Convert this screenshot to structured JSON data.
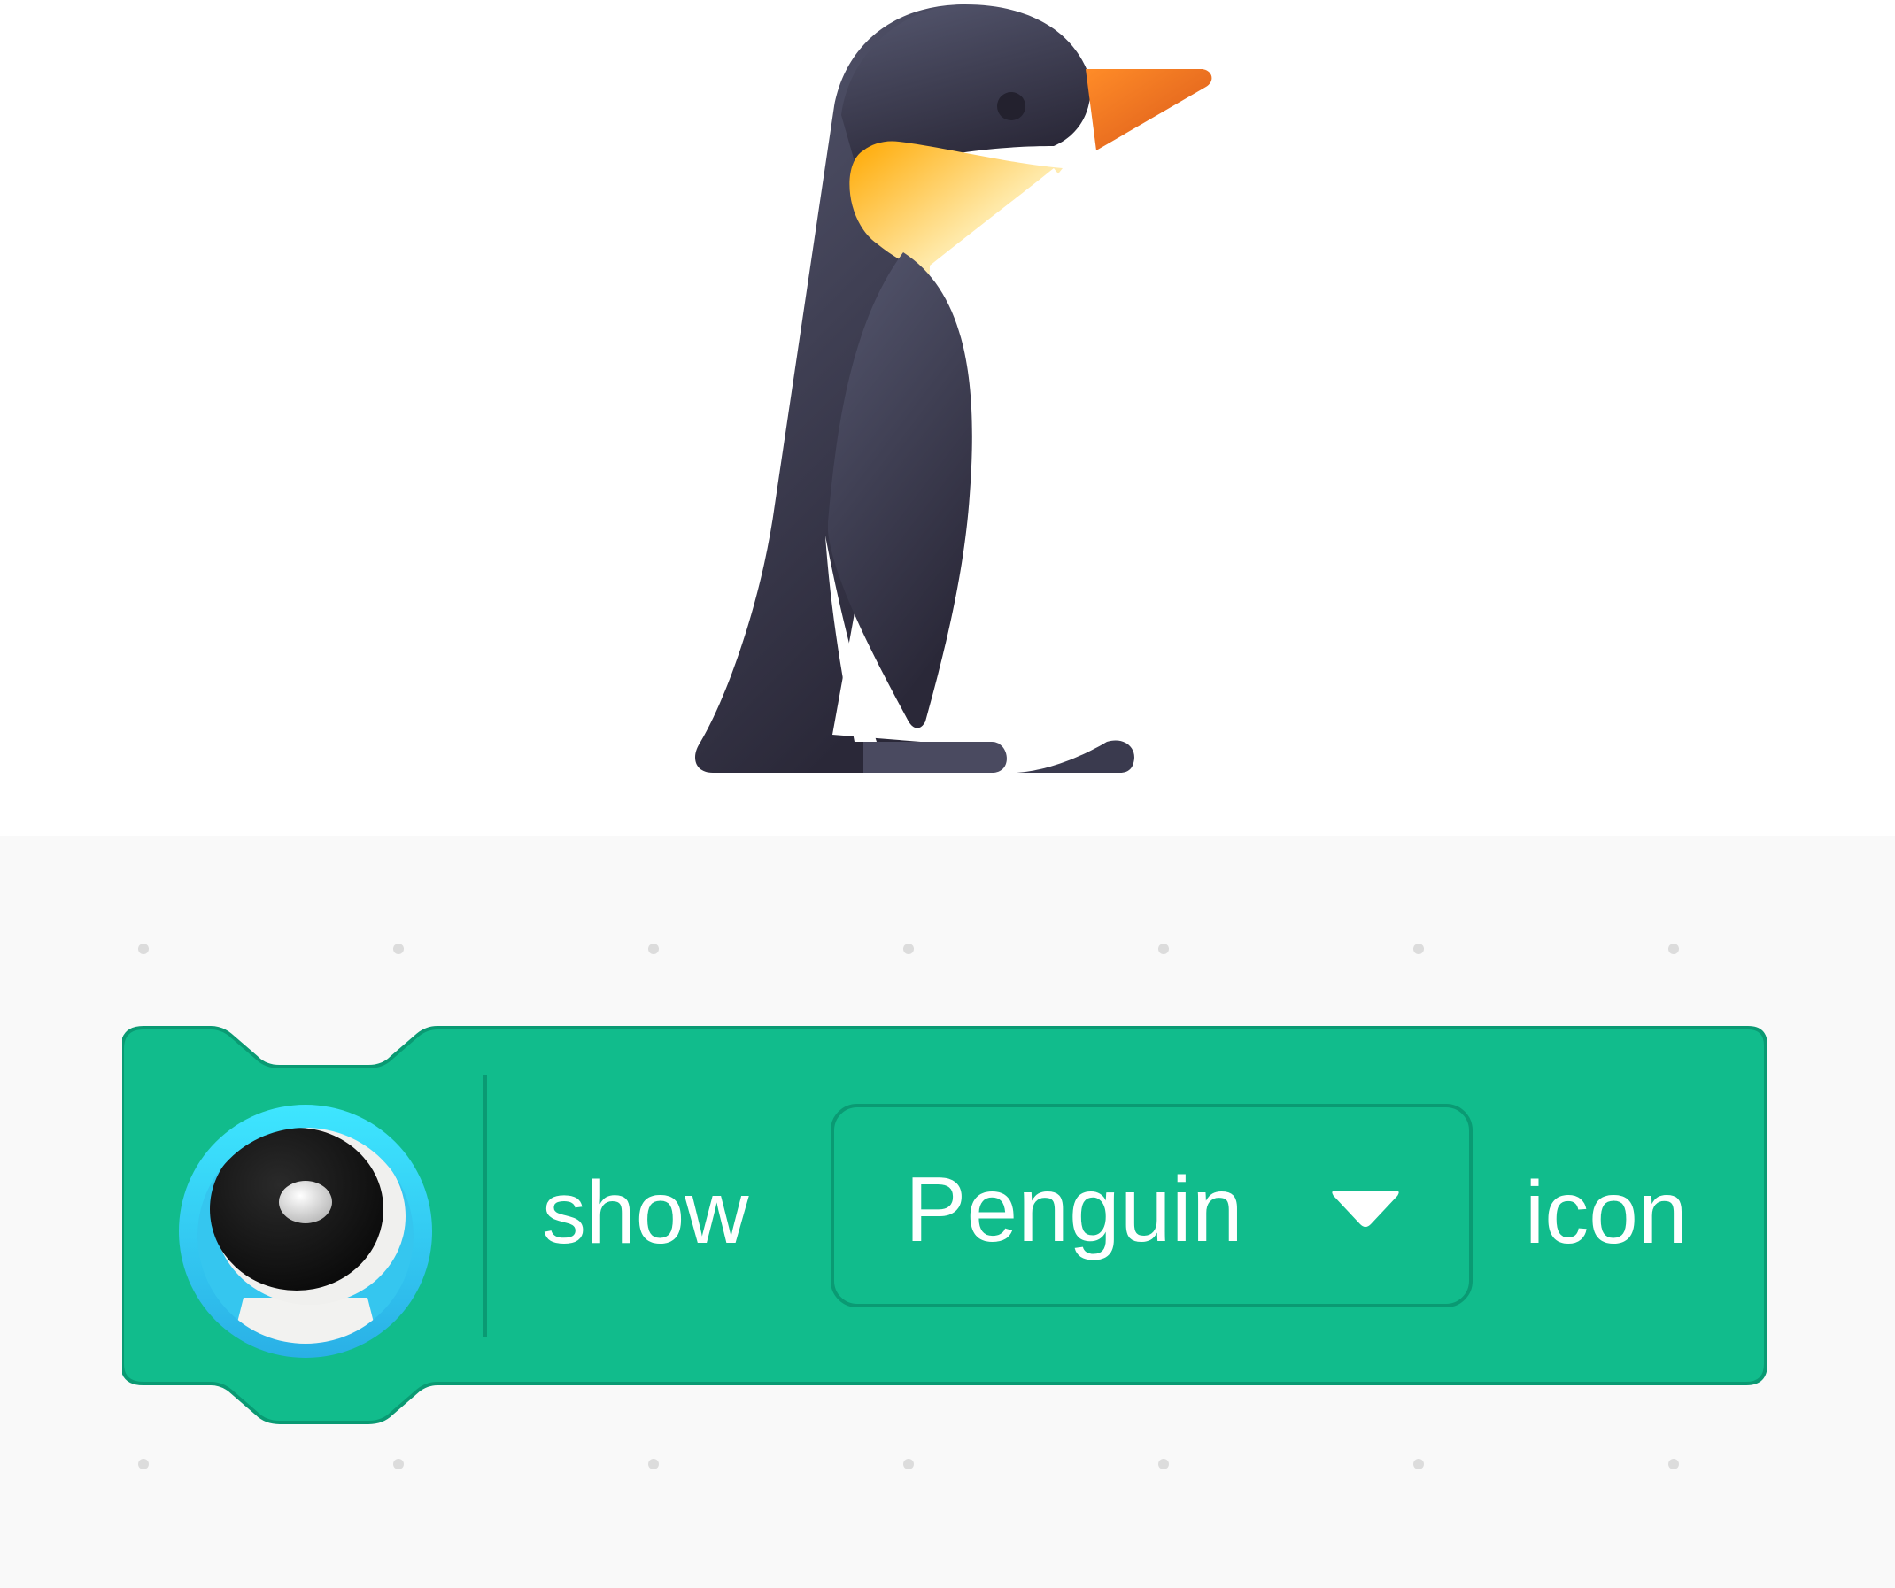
{
  "stage": {
    "sprite_icon": "penguin-icon"
  },
  "block": {
    "category_icon": "robot-icon",
    "show_label": "show",
    "dropdown_value": "Penguin",
    "icon_label": "icon",
    "colors": {
      "fill": "#11bc8c",
      "stroke": "#0a9a73",
      "text": "#ffffff"
    }
  },
  "workspace": {
    "background_color": "#f9f9f9"
  }
}
